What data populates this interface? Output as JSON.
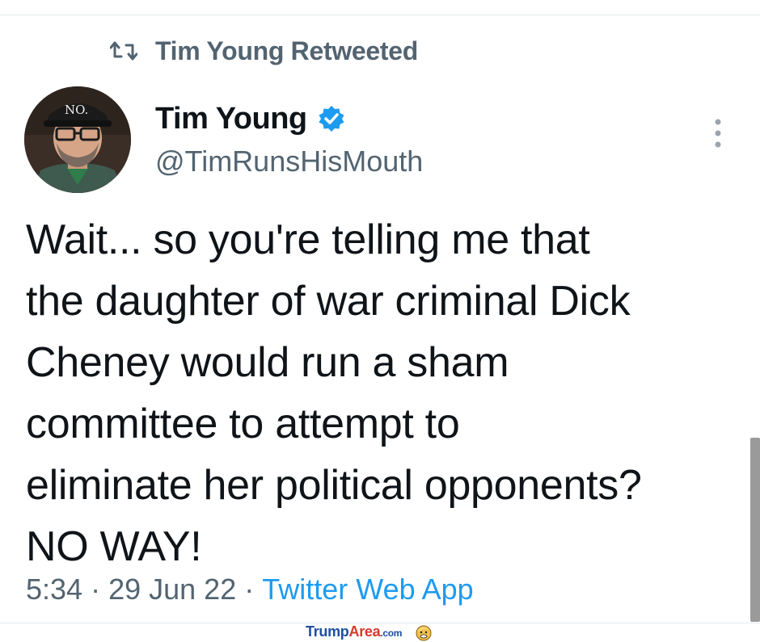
{
  "retweet": {
    "icon": "retweet-icon",
    "text": "Tim Young Retweeted"
  },
  "author": {
    "avatar_icon": "avatar-photo",
    "hat_text": "NO.",
    "name": "Tim Young",
    "verified_icon": "verified-badge-icon",
    "handle": "@TimRunsHisMouth"
  },
  "tweet": {
    "text": "Wait... so you're telling me that\nthe daughter of war criminal Dick\nCheney would run a sham\ncommittee to attempt to\neliminate her political opponents?\nNO WAY!"
  },
  "meta": {
    "time": "5:34",
    "sep1": "·",
    "date": "29 Jun 22",
    "sep2": "·",
    "source": "Twitter Web App"
  },
  "menu_icon": "more-vertical-icon",
  "watermark": {
    "brand_a": "Trump",
    "brand_b": "Area",
    "brand_c": ".com",
    "face_icon": "trump-face-logo"
  },
  "colors": {
    "verified_blue": "#1d9bf0",
    "link_blue": "#1d9bf0",
    "secondary_text": "#536471",
    "primary_text": "#0f1419"
  }
}
